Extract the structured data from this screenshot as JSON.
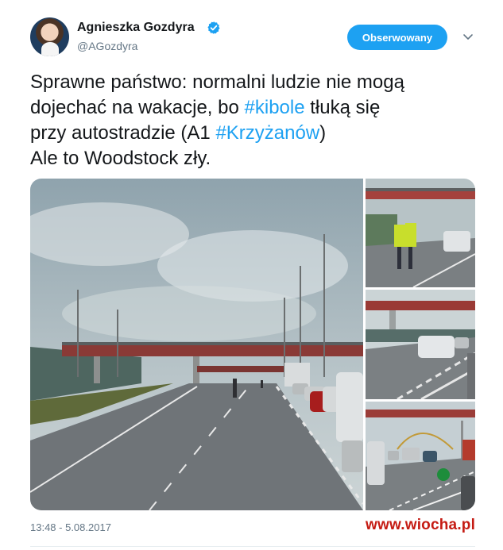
{
  "author": {
    "name": "Agnieszka Gozdyra",
    "handle": "@AGozdyra",
    "verified_icon": "verified-badge-icon"
  },
  "actions": {
    "follow_label": "Obserwowany",
    "menu_icon": "chevron-down-icon"
  },
  "tweet": {
    "line1": "Sprawne państwo: normalni ludzie nie mogą",
    "line2_before": "dojechać na wakacje, bo ",
    "hashtag_kibole": "#kibole",
    "line2_after": " tłuką się",
    "line3_before": "przy autostradzie (A1 ",
    "hashtag_krzyzanow": "#Krzyżanów",
    "line3_after": ")",
    "line4": "Ale to Woodstock zły."
  },
  "timestamp": "13:48 - 5.08.2017",
  "watermark": "www.wiocha.pl",
  "colors": {
    "accent": "#1da1f2",
    "text": "#14171a",
    "muted": "#657786",
    "watermark": "#c51b13"
  }
}
